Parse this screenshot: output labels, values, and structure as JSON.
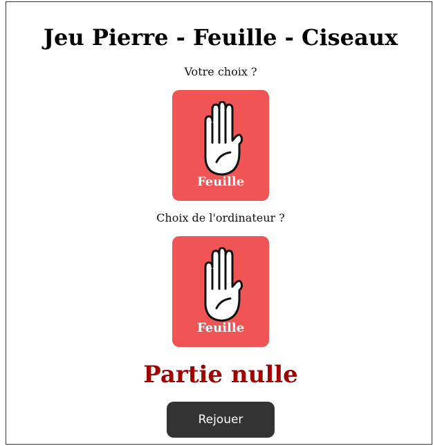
{
  "game": {
    "title": "Jeu Pierre - Feuille - Ciseaux",
    "player_prompt": "Votre choix ?",
    "computer_prompt": "Choix de l'ordinateur ?"
  },
  "player_choice": {
    "label": "Feuille",
    "icon": "hand-paper-icon"
  },
  "computer_choice": {
    "label": "Feuille",
    "icon": "hand-paper-icon"
  },
  "result": {
    "text": "Partie nulle",
    "color": "#a00000"
  },
  "replay_button": {
    "label": "Rejouer"
  },
  "colors": {
    "card_background": "#f05454",
    "button_background": "#333333"
  }
}
